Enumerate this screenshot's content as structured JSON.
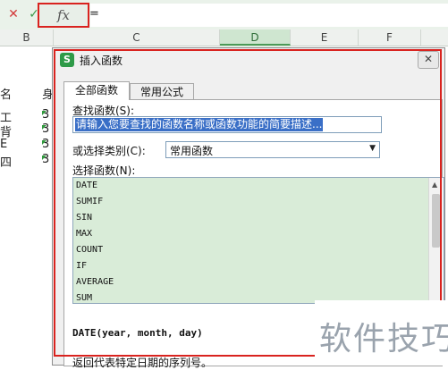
{
  "formula_bar": {
    "cancel_icon": "✕",
    "confirm_icon": "✓",
    "fx_label": "fx",
    "value": "="
  },
  "columns": [
    "B",
    "C",
    "D",
    "E",
    "F"
  ],
  "cells": {
    "row_names": [
      "名",
      "工",
      "背",
      "E",
      "四"
    ],
    "row_partials": [
      "身",
      "3",
      "3",
      "3",
      "3"
    ]
  },
  "dialog": {
    "logo": "S",
    "title": "插入函数",
    "close": "✕",
    "tabs": [
      "全部函数",
      "常用公式"
    ],
    "search_label": "查找函数(S):",
    "search_placeholder": "请输入您要查找的函数名称或函数功能的简要描述...",
    "category_label": "或选择类别(C):",
    "category_value": "常用函数",
    "function_label": "选择函数(N):",
    "functions": [
      "DATE",
      "SUMIF",
      "SIN",
      "MAX",
      "COUNT",
      "IF",
      "AVERAGE",
      "SUM"
    ],
    "syntax": "DATE(year, month, day)",
    "description": "返回代表特定日期的序列号。"
  },
  "watermark": "软件技巧",
  "colors": {
    "highlight_red": "#d9231f",
    "selection_green": "#cfe6d0",
    "accent_green": "#2e9a48"
  }
}
